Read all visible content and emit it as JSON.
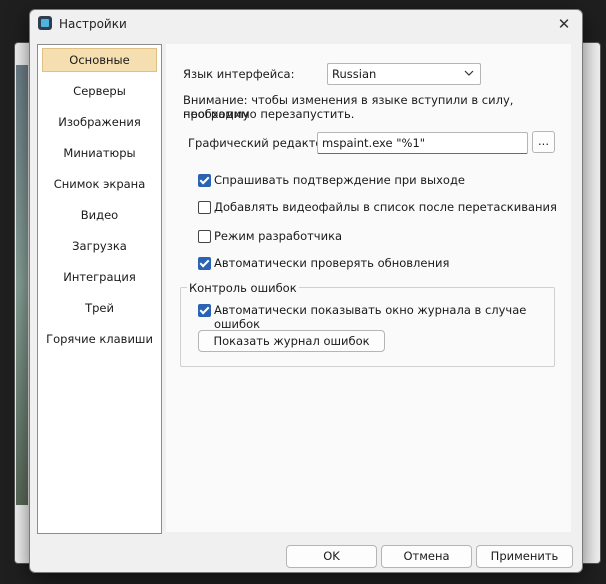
{
  "window": {
    "title": "Настройки",
    "close_glyph": "✕"
  },
  "sidebar": {
    "items": [
      {
        "label": "Основные"
      },
      {
        "label": "Серверы"
      },
      {
        "label": "Изображения"
      },
      {
        "label": "Миниатюры"
      },
      {
        "label": "Снимок экрана"
      },
      {
        "label": "Видео"
      },
      {
        "label": "Загрузка"
      },
      {
        "label": "Интеграция"
      },
      {
        "label": "Трей"
      },
      {
        "label": "Горячие клавиши"
      }
    ],
    "active_index": 0
  },
  "general": {
    "language_label": "Язык интерфейса:",
    "language_value": "Russian",
    "language_note_line1": "Внимание: чтобы изменения в языке вступили в силу, программу",
    "language_note_line2": "необходимо перезапустить.",
    "editor_label": "Графический редактор:",
    "editor_value": "mspaint.exe \"%1\"",
    "browse_label": "...",
    "options": [
      {
        "label": "Спрашивать подтверждение при выходе",
        "checked": true
      },
      {
        "label": "Добавлять видеофайлы в список после перетаскивания",
        "checked": false
      },
      {
        "label": "Режим разработчика",
        "checked": false
      },
      {
        "label": "Автоматически проверять обновления",
        "checked": true
      }
    ],
    "errors_group": {
      "title": "Контроль ошибок",
      "auto_show_label": "Автоматически показывать окно журнала в случае ошибок",
      "auto_show_checked": true,
      "show_log_button": "Показать журнал ошибок"
    }
  },
  "footer": {
    "ok": "OK",
    "cancel": "Отмена",
    "apply": "Применить"
  },
  "colors": {
    "accent": "#2b63b4",
    "active_nav": "#f5deb0"
  }
}
